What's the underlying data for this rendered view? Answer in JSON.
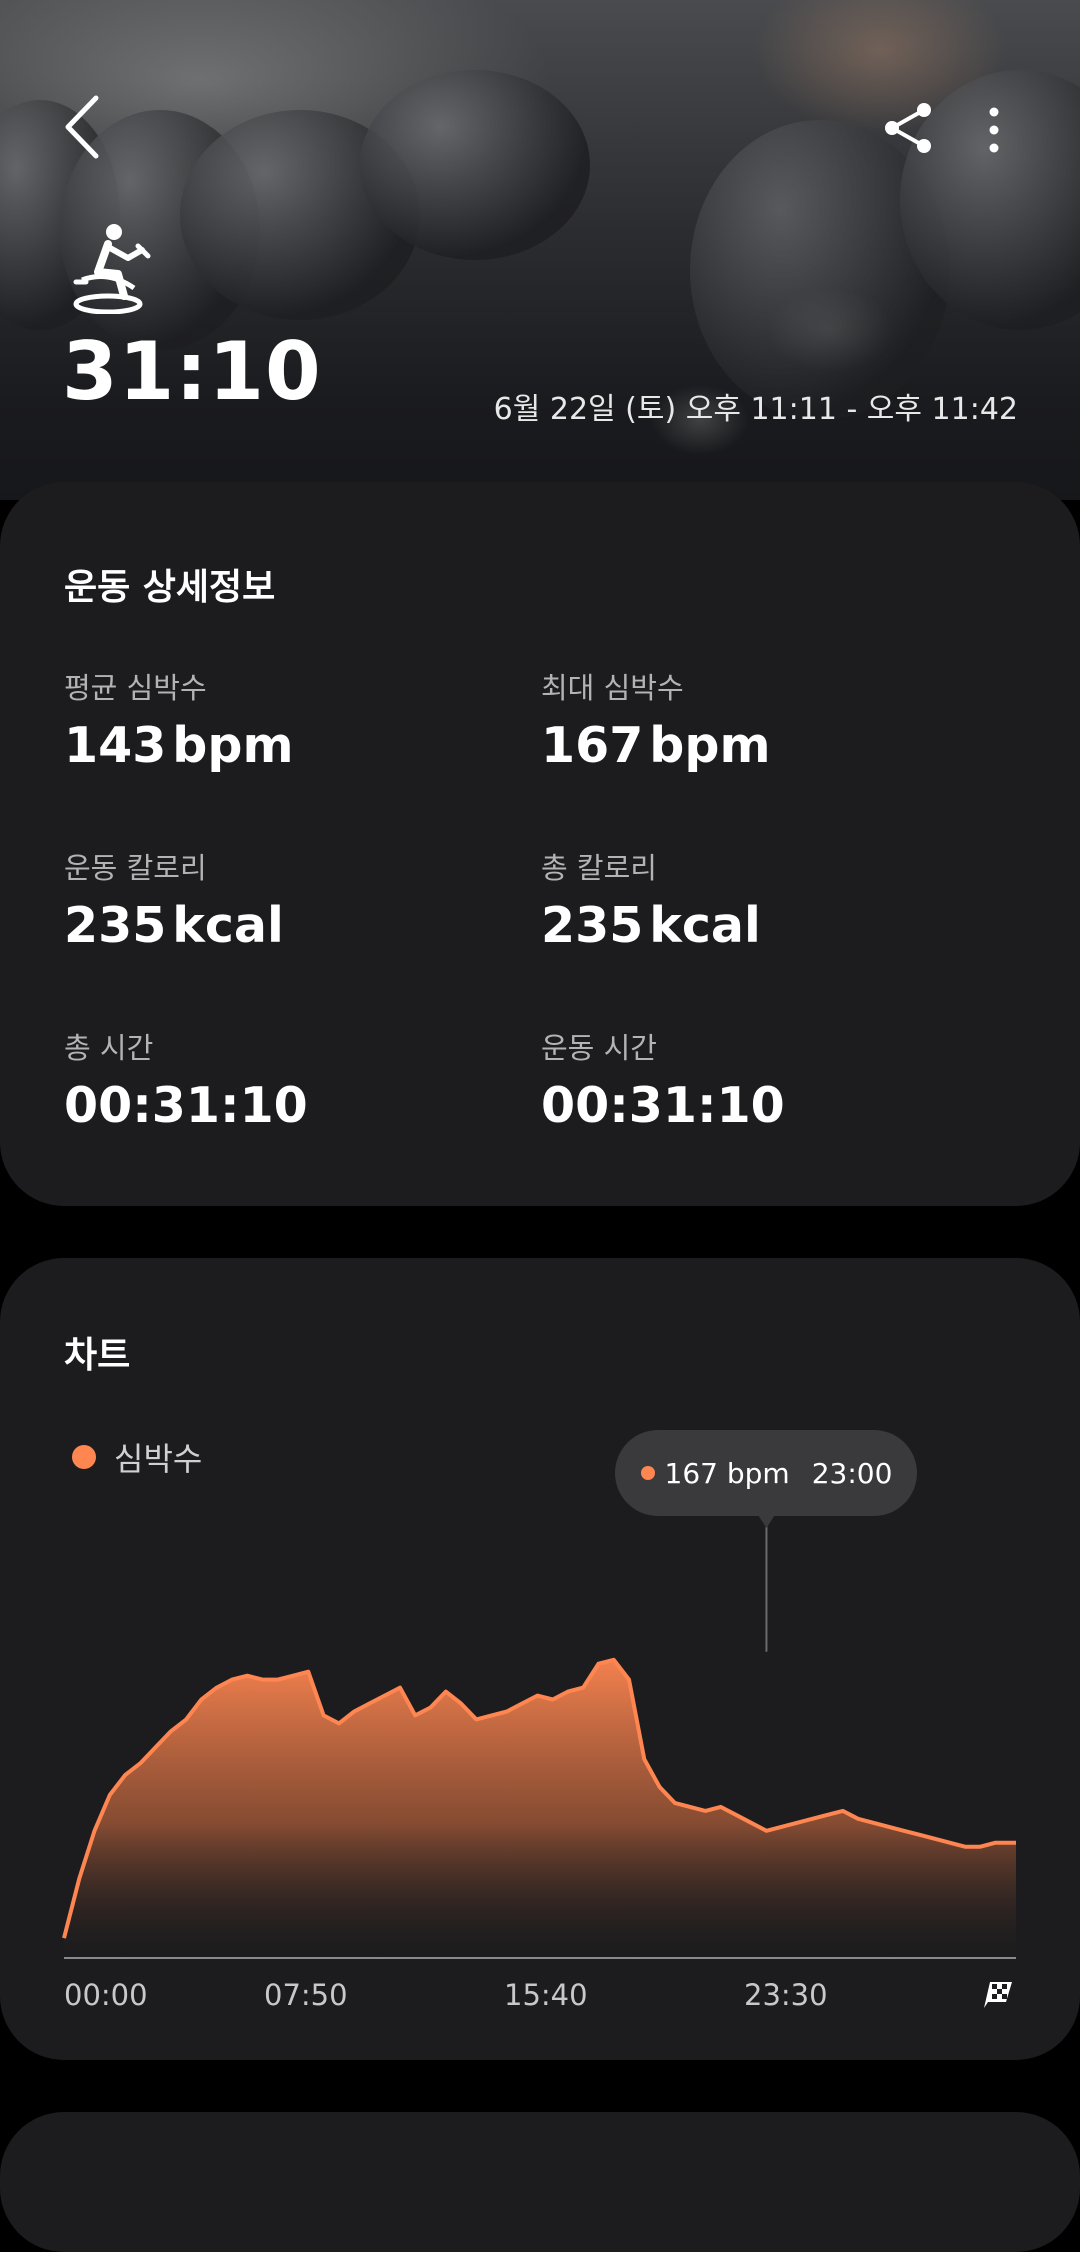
{
  "workout": {
    "activity_icon": "exercise-bike-icon",
    "duration": "31:10",
    "date_range": "6월 22일 (토) 오후 11:11 - 오후 11:42"
  },
  "toolbar": {
    "back_icon": "chevron-left-icon",
    "share_icon": "share-icon",
    "more_icon": "more-vertical-icon"
  },
  "details": {
    "title": "운동 상세정보",
    "avg_hr": {
      "label": "평균 심박수",
      "value": "143",
      "unit": "bpm"
    },
    "max_hr": {
      "label": "최대 심박수",
      "value": "167",
      "unit": "bpm"
    },
    "workout_calories": {
      "label": "운동 칼로리",
      "value": "235",
      "unit": "kcal"
    },
    "total_calories": {
      "label": "총 칼로리",
      "value": "235",
      "unit": "kcal"
    },
    "total_time": {
      "label": "총 시간",
      "value": "00:31:10"
    },
    "workout_time": {
      "label": "운동 시간",
      "value": "00:31:10"
    }
  },
  "chart_section": {
    "title": "차트",
    "legend_label": "심박수",
    "tooltip": {
      "value": "167 bpm",
      "time": "23:00"
    },
    "finish_icon": "checkered-flag-icon"
  },
  "colors": {
    "accent": "#ff8651",
    "card_background": "#1c1c1e",
    "page_background": "#000000"
  },
  "chart_data": {
    "type": "area",
    "series": [
      {
        "name": "심박수",
        "x_minutes": [
          0,
          0.5,
          1,
          1.5,
          2,
          2.5,
          3,
          3.5,
          4,
          4.5,
          5,
          5.5,
          6,
          6.5,
          7,
          7.5,
          8,
          8.5,
          9,
          9.5,
          10,
          10.5,
          11,
          11.5,
          12,
          12.5,
          13,
          13.5,
          14,
          14.5,
          15,
          15.5,
          16,
          16.5,
          17,
          17.5,
          18,
          18.5,
          19,
          19.5,
          20,
          20.5,
          21,
          21.5,
          22,
          22.5,
          23,
          23.5,
          24,
          24.5,
          25,
          25.5,
          26,
          26.5,
          27,
          27.5,
          28,
          28.5,
          29,
          29.5,
          30,
          30.5,
          31.17
        ],
        "values": [
          95,
          110,
          122,
          131,
          136,
          139,
          143,
          147,
          150,
          155,
          158,
          160,
          161,
          160,
          160,
          161,
          162,
          151,
          149,
          152,
          154,
          156,
          158,
          151,
          153,
          157,
          154,
          150,
          151,
          152,
          154,
          156,
          155,
          157,
          158,
          164,
          165,
          160,
          140,
          133,
          129,
          128,
          127,
          128,
          126,
          124,
          122,
          123,
          124,
          125,
          126,
          127,
          125,
          124,
          123,
          122,
          121,
          120,
          119,
          118,
          118,
          119,
          119
        ]
      }
    ],
    "x_tick_labels": [
      "00:00",
      "07:50",
      "15:40",
      "23:30"
    ],
    "x_range_minutes": [
      0,
      31.17
    ],
    "y_range": [
      90,
      175
    ],
    "highlight": {
      "x_minutes": 23.0,
      "value": 167,
      "label": "167 bpm",
      "time": "23:00"
    },
    "grid": false,
    "legend": "top-left"
  }
}
